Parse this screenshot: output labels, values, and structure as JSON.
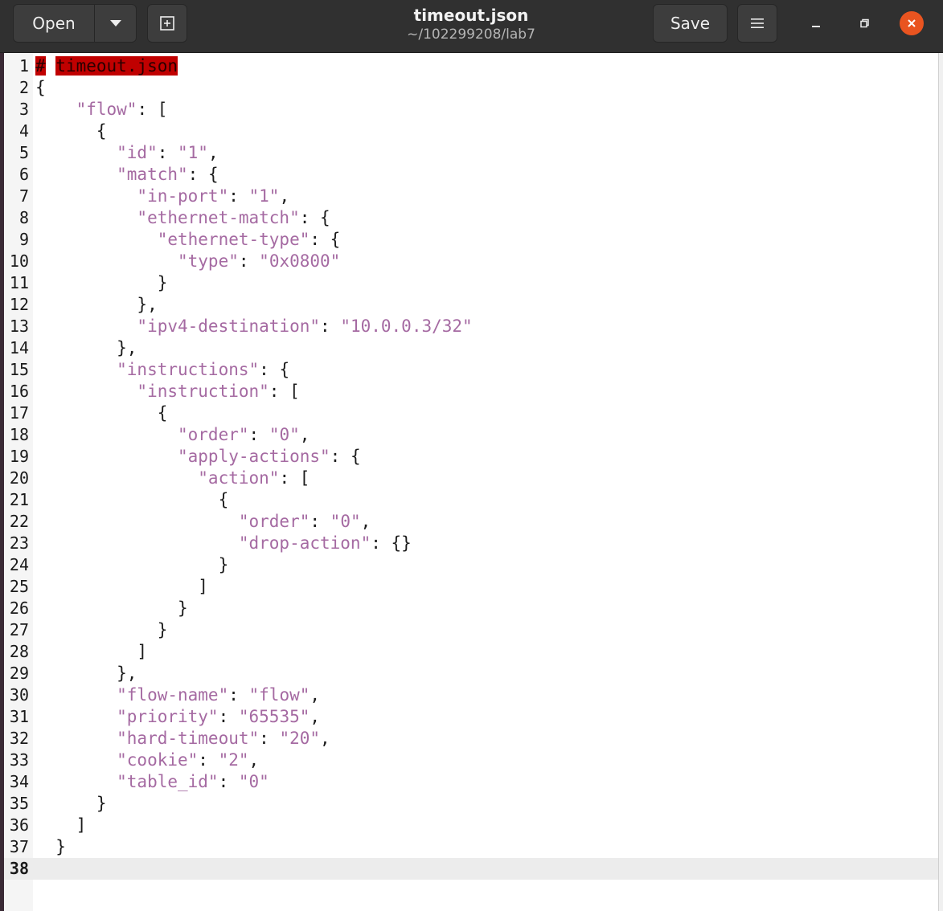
{
  "header": {
    "open_label": "Open",
    "save_label": "Save",
    "title": "timeout.json",
    "subtitle": "~/102299208/lab7"
  },
  "editor": {
    "current_line": 38,
    "lines": [
      [
        {
          "t": "#",
          "c": "err"
        },
        {
          "t": " ",
          "c": "punc"
        },
        {
          "t": "timeout.json",
          "c": "err"
        }
      ],
      [
        {
          "t": "{",
          "c": "punc"
        }
      ],
      [
        {
          "t": "    \"flow\"",
          "c": "str"
        },
        {
          "t": ": [",
          "c": "punc"
        }
      ],
      [
        {
          "t": "      {",
          "c": "punc"
        }
      ],
      [
        {
          "t": "        \"id\"",
          "c": "str"
        },
        {
          "t": ": ",
          "c": "punc"
        },
        {
          "t": "\"1\"",
          "c": "str"
        },
        {
          "t": ",",
          "c": "punc"
        }
      ],
      [
        {
          "t": "        \"match\"",
          "c": "str"
        },
        {
          "t": ": {",
          "c": "punc"
        }
      ],
      [
        {
          "t": "          \"in-port\"",
          "c": "str"
        },
        {
          "t": ": ",
          "c": "punc"
        },
        {
          "t": "\"1\"",
          "c": "str"
        },
        {
          "t": ",",
          "c": "punc"
        }
      ],
      [
        {
          "t": "          \"ethernet-match\"",
          "c": "str"
        },
        {
          "t": ": {",
          "c": "punc"
        }
      ],
      [
        {
          "t": "            \"ethernet-type\"",
          "c": "str"
        },
        {
          "t": ": {",
          "c": "punc"
        }
      ],
      [
        {
          "t": "              \"type\"",
          "c": "str"
        },
        {
          "t": ": ",
          "c": "punc"
        },
        {
          "t": "\"0x0800\"",
          "c": "str"
        }
      ],
      [
        {
          "t": "            }",
          "c": "punc"
        }
      ],
      [
        {
          "t": "          },",
          "c": "punc"
        }
      ],
      [
        {
          "t": "          \"ipv4-destination\"",
          "c": "str"
        },
        {
          "t": ": ",
          "c": "punc"
        },
        {
          "t": "\"10.0.0.3/32\"",
          "c": "str"
        }
      ],
      [
        {
          "t": "        },",
          "c": "punc"
        }
      ],
      [
        {
          "t": "        \"instructions\"",
          "c": "str"
        },
        {
          "t": ": {",
          "c": "punc"
        }
      ],
      [
        {
          "t": "          \"instruction\"",
          "c": "str"
        },
        {
          "t": ": [",
          "c": "punc"
        }
      ],
      [
        {
          "t": "            {",
          "c": "punc"
        }
      ],
      [
        {
          "t": "              \"order\"",
          "c": "str"
        },
        {
          "t": ": ",
          "c": "punc"
        },
        {
          "t": "\"0\"",
          "c": "str"
        },
        {
          "t": ",",
          "c": "punc"
        }
      ],
      [
        {
          "t": "              \"apply-actions\"",
          "c": "str"
        },
        {
          "t": ": {",
          "c": "punc"
        }
      ],
      [
        {
          "t": "                \"action\"",
          "c": "str"
        },
        {
          "t": ": [",
          "c": "punc"
        }
      ],
      [
        {
          "t": "                  {",
          "c": "punc"
        }
      ],
      [
        {
          "t": "                    \"order\"",
          "c": "str"
        },
        {
          "t": ": ",
          "c": "punc"
        },
        {
          "t": "\"0\"",
          "c": "str"
        },
        {
          "t": ",",
          "c": "punc"
        }
      ],
      [
        {
          "t": "                    \"drop-action\"",
          "c": "str"
        },
        {
          "t": ": {}",
          "c": "punc"
        }
      ],
      [
        {
          "t": "                  }",
          "c": "punc"
        }
      ],
      [
        {
          "t": "                ]",
          "c": "punc"
        }
      ],
      [
        {
          "t": "              }",
          "c": "punc"
        }
      ],
      [
        {
          "t": "            }",
          "c": "punc"
        }
      ],
      [
        {
          "t": "          ]",
          "c": "punc"
        }
      ],
      [
        {
          "t": "        },",
          "c": "punc"
        }
      ],
      [
        {
          "t": "        \"flow-name\"",
          "c": "str"
        },
        {
          "t": ": ",
          "c": "punc"
        },
        {
          "t": "\"flow\"",
          "c": "str"
        },
        {
          "t": ",",
          "c": "punc"
        }
      ],
      [
        {
          "t": "        \"priority\"",
          "c": "str"
        },
        {
          "t": ": ",
          "c": "punc"
        },
        {
          "t": "\"65535\"",
          "c": "str"
        },
        {
          "t": ",",
          "c": "punc"
        }
      ],
      [
        {
          "t": "        \"hard-timeout\"",
          "c": "str"
        },
        {
          "t": ": ",
          "c": "punc"
        },
        {
          "t": "\"20\"",
          "c": "str"
        },
        {
          "t": ",",
          "c": "punc"
        }
      ],
      [
        {
          "t": "        \"cookie\"",
          "c": "str"
        },
        {
          "t": ": ",
          "c": "punc"
        },
        {
          "t": "\"2\"",
          "c": "str"
        },
        {
          "t": ",",
          "c": "punc"
        }
      ],
      [
        {
          "t": "        \"table_id\"",
          "c": "str"
        },
        {
          "t": ": ",
          "c": "punc"
        },
        {
          "t": "\"0\"",
          "c": "str"
        }
      ],
      [
        {
          "t": "      }",
          "c": "punc"
        }
      ],
      [
        {
          "t": "    ]",
          "c": "punc"
        }
      ],
      [
        {
          "t": "  }",
          "c": "punc"
        }
      ],
      []
    ]
  },
  "colors": {
    "headerbar": "#303030",
    "string": "#a56aa2",
    "error_highlight": "#c00000",
    "close_button": "#e95420"
  },
  "icons": {
    "open_dropdown": "chevron-down-icon",
    "new_tab": "new-document-icon",
    "menu": "hamburger-menu-icon",
    "minimize": "minimize-icon",
    "maximize": "maximize-icon",
    "close": "close-icon"
  }
}
